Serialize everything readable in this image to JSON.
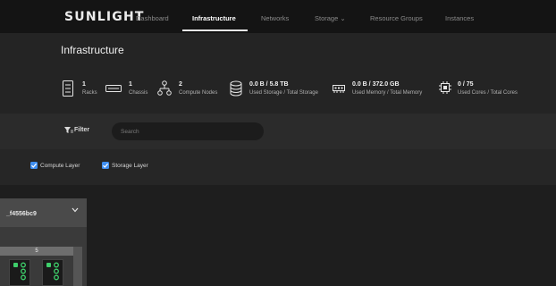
{
  "app": {
    "logo": "SUNLIGHT"
  },
  "nav": {
    "items": [
      {
        "label": "Dashboard"
      },
      {
        "label": "Infrastructure"
      },
      {
        "label": "Networks"
      },
      {
        "label": "Storage ⌄"
      },
      {
        "label": "Resource Groups"
      },
      {
        "label": "Instances"
      }
    ],
    "active": "Infrastructure"
  },
  "page": {
    "title": "Infrastructure"
  },
  "stats": [
    {
      "value": "1",
      "label": "Racks",
      "icon": "rack-icon"
    },
    {
      "value": "1",
      "label": "Chassis",
      "icon": "chassis-icon"
    },
    {
      "value": "2",
      "label": "Compute Nodes",
      "icon": "compute-nodes-icon"
    },
    {
      "value": "0.0 B / 5.8 TB",
      "label": "Used Storage / Total Storage",
      "icon": "storage-icon"
    },
    {
      "value": "0.0 B / 372.0 GB",
      "label": "Used Memory / Total Memory",
      "icon": "memory-icon"
    },
    {
      "value": "0 / 75",
      "label": "Used Cores / Total Cores",
      "icon": "cpu-icon"
    }
  ],
  "filter": {
    "label": "Filter",
    "placeholder": "Search"
  },
  "layers": [
    {
      "label": "Compute Layer",
      "checked": true
    },
    {
      "label": "Storage Layer",
      "checked": true
    }
  ],
  "rack": {
    "name": "_f4556bc9",
    "unit": "5"
  },
  "colors": {
    "accent": "#3f8ef0",
    "node_led": "#3ecf6b"
  }
}
